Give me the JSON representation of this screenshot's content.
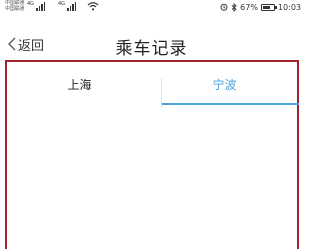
{
  "status_bar": {
    "carrier_1": "中国联通",
    "carrier_2": "中国联通",
    "network_1": "4G",
    "network_2": "4G",
    "battery": "67%",
    "time": "10:03",
    "icons": [
      "signal-icon",
      "wifi-icon",
      "alarm-icon",
      "bluetooth-icon",
      "battery-icon"
    ]
  },
  "nav": {
    "back_label": "返回",
    "title": "乘车记录"
  },
  "tabs": [
    {
      "label": "上海",
      "selected": false
    },
    {
      "label": "宁波",
      "selected": true
    }
  ],
  "colors": {
    "accent": "#4aa3df",
    "frame": "#a1252f",
    "text": "#222222"
  }
}
